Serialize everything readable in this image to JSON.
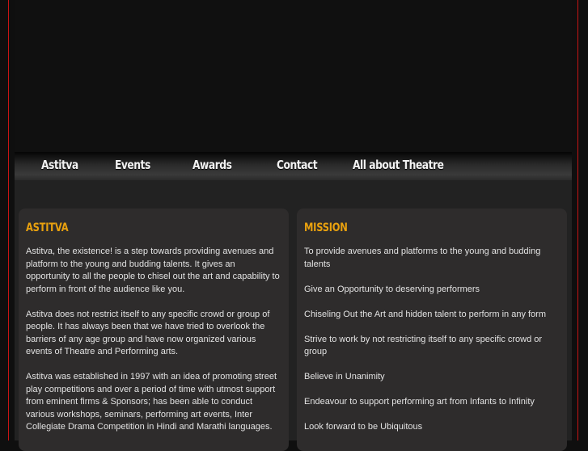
{
  "nav": [
    "Astitva",
    "Events",
    "Awards",
    "Contact",
    "All about Theatre"
  ],
  "colors": {
    "accent": "#e9a10e",
    "border": "#c81414"
  },
  "astitva": {
    "title": "ASTITVA",
    "paragraphs": [
      "Astitva, the existence! is a step towards providing avenues and platform to the young and budding talents. It gives an opportunity to all the people to chisel out the art and capability to perform in front of the audience like you.",
      "Astitva does not restrict itself to any specific crowd or group of people. It has always been that we have tried to overlook the barriers of any age group and have now organized various events of Theatre and Performing arts.",
      "Astitva was established in 1997 with an idea of promoting street play competitions and over a period of time with utmost support from eminent firms & Sponsors; has been able to conduct various workshops, seminars, performing art events, Inter Collegiate Drama Competition in Hindi and Marathi languages."
    ]
  },
  "mission": {
    "title": "MISSION",
    "items": [
      "To provide avenues and platforms to the young and budding talents",
      "Give an Opportunity to deserving performers",
      "Chiseling Out the Art and hidden talent to perform in any form",
      "Strive to work by not restricting itself to any specific crowd or group",
      "Believe in Unanimity",
      "Endeavour to support performing art from Infants to Infinity",
      "Look forward to be Ubiquitous"
    ]
  }
}
